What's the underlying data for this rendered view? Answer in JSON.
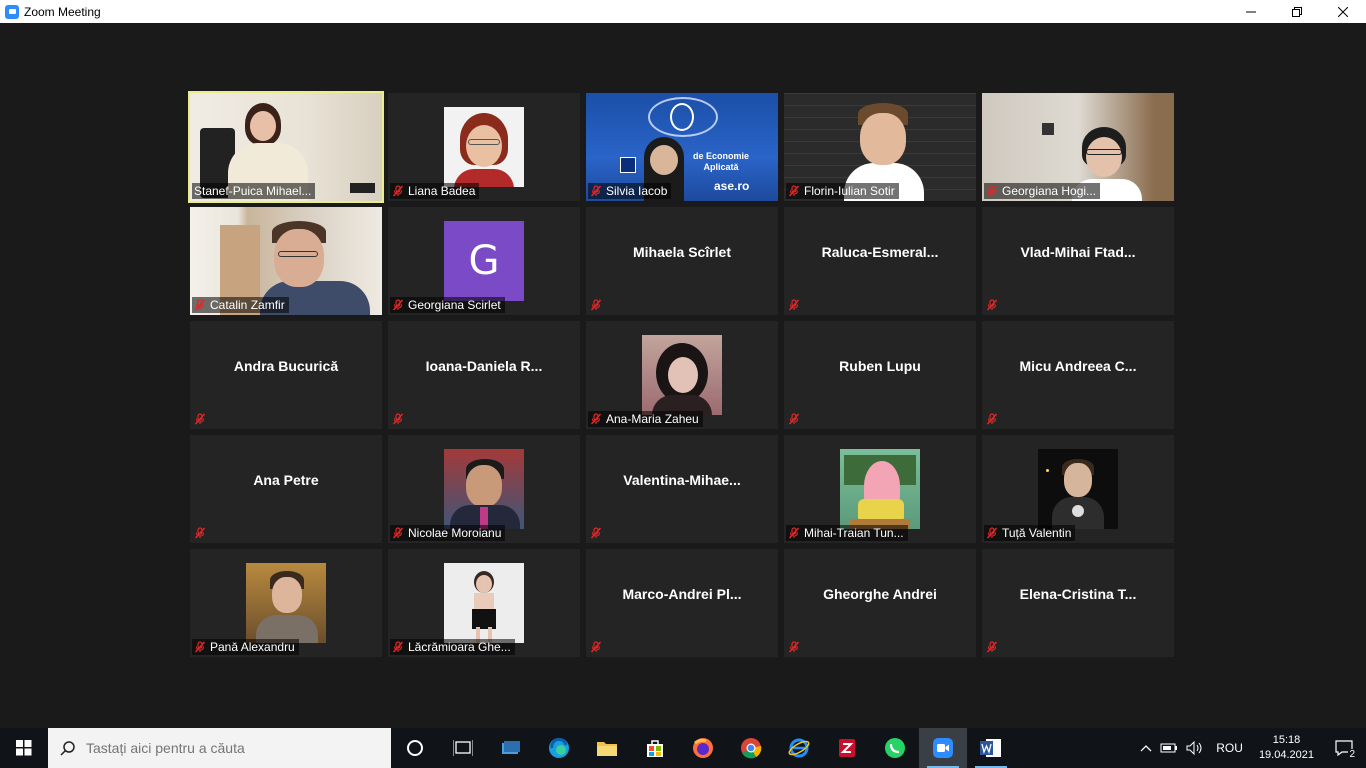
{
  "window": {
    "title": "Zoom Meeting"
  },
  "participants": [
    {
      "name": "Stanef-Puica Mihael...",
      "display": "video",
      "active": true
    },
    {
      "name": "Liana Badea",
      "display": "photo"
    },
    {
      "name": "Silvia Iacob",
      "display": "video",
      "bg_texts": [
        "de Economie",
        "Aplicată",
        "ase.ro"
      ]
    },
    {
      "name": "Florin-Iulian Sotir",
      "display": "video"
    },
    {
      "name": "Georgiana Hogi...",
      "display": "video"
    },
    {
      "name": "Catalin Zamfir",
      "display": "video"
    },
    {
      "name": "Georgiana Scirlet",
      "display": "avatar",
      "initial": "G"
    },
    {
      "name": "Mihaela Scîrlet",
      "display": "name"
    },
    {
      "name": "Raluca-Esmeral...",
      "display": "name"
    },
    {
      "name": "Vlad-Mihai  Ftad...",
      "display": "name"
    },
    {
      "name": "Andra Bucurică",
      "display": "name"
    },
    {
      "name": "Ioana-Daniela  R...",
      "display": "name"
    },
    {
      "name": "Ana-Maria Zaheu",
      "display": "photo"
    },
    {
      "name": "Ruben Lupu",
      "display": "name"
    },
    {
      "name": "Micu  Andreea  C...",
      "display": "name"
    },
    {
      "name": "Ana Petre",
      "display": "name"
    },
    {
      "name": "Nicolae Moroianu",
      "display": "photo"
    },
    {
      "name": "Valentina-Mihae...",
      "display": "name"
    },
    {
      "name": "Mihai-Traian Tun...",
      "display": "photo"
    },
    {
      "name": "Tuță Valentin",
      "display": "photo"
    },
    {
      "name": "Pană Alexandru",
      "display": "photo"
    },
    {
      "name": "Lăcrămioara Ghe...",
      "display": "photo"
    },
    {
      "name": "Marco-Andrei  Pl...",
      "display": "name"
    },
    {
      "name": "Gheorghe Andrei",
      "display": "name"
    },
    {
      "name": "Elena-Cristina  T...",
      "display": "name"
    }
  ],
  "taskbar": {
    "search_placeholder": "Tastați aici pentru a căuta",
    "language": "ROU",
    "time": "15:18",
    "date": "19.04.2021",
    "notifications": "2"
  },
  "colors": {
    "active_speaker": "#e9ee8a",
    "mute": "#e02828",
    "accent": "#2d8cff"
  }
}
